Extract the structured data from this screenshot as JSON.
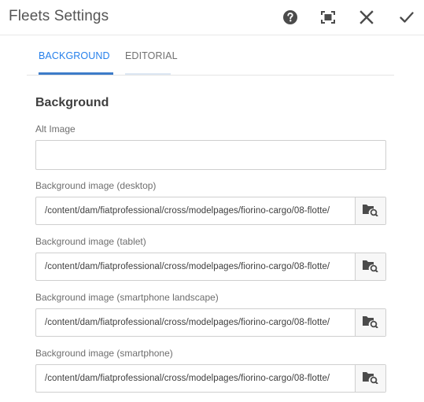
{
  "dialog": {
    "title": "Fleets Settings",
    "actions": {
      "help": "help-icon",
      "fullscreen": "fullscreen-icon",
      "close": "close-icon",
      "done": "checkmark-icon"
    }
  },
  "tabs": [
    {
      "label": "BACKGROUND",
      "selected": true
    },
    {
      "label": "EDITORIAL",
      "selected": false
    }
  ],
  "section": {
    "title": "Background"
  },
  "fields": {
    "alt_image": {
      "label": "Alt Image",
      "value": ""
    },
    "desktop": {
      "label": "Background image (desktop)",
      "value": "/content/dam/fiatprofessional/cross/modelpages/fiorino-cargo/08-flotte/"
    },
    "tablet": {
      "label": "Background image (tablet)",
      "value": "/content/dam/fiatprofessional/cross/modelpages/fiorino-cargo/08-flotte/"
    },
    "smartphone_landscape": {
      "label": "Background image (smartphone landscape)",
      "value": "/content/dam/fiatprofessional/cross/modelpages/fiorino-cargo/08-flotte/"
    },
    "smartphone": {
      "label": "Background image (smartphone)",
      "value": "/content/dam/fiatprofessional/cross/modelpages/fiorino-cargo/08-flotte/"
    }
  },
  "colors": {
    "accent": "#2680eb",
    "tab_underline": "#3d7cc9"
  }
}
